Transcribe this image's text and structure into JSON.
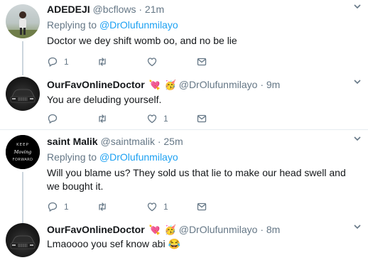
{
  "tweets": [
    {
      "name": "ADEDEJI",
      "handle": "@bcflows",
      "time": "· 21m",
      "replying_prefix": "Replying to",
      "replying_to": "@DrOlufunmilayo",
      "text": "Doctor we dey shift womb oo, and no be lie",
      "reply_count": "1",
      "retweet_count": "",
      "like_count": ""
    },
    {
      "name": "OurFavOnlineDoctor",
      "emojis": [
        "💘",
        "🥳"
      ],
      "handle": "@DrOlufunmilayo",
      "time": "· 9m",
      "text": "You are deluding yourself.",
      "reply_count": "",
      "retweet_count": "",
      "like_count": "1"
    },
    {
      "name": "saint Malik",
      "handle": "@saintmalik",
      "time": "· 25m",
      "replying_prefix": "Replying to",
      "replying_to": "@DrOlufunmilayo",
      "avatar_text": "KEEP MOVING FORWARD",
      "text": "Will you blame us? They sold us that lie to make our head swell and we bought it.",
      "reply_count": "1",
      "retweet_count": "",
      "like_count": "1"
    },
    {
      "name": "OurFavOnlineDoctor",
      "emojis": [
        "💘",
        "🥳"
      ],
      "handle": "@DrOlufunmilayo",
      "time": "· 8m",
      "text": "Lmaoooo you sef know abi 😂"
    }
  ],
  "colors": {
    "link": "#1da1f2",
    "muted": "#657786",
    "text": "#14171a",
    "divider": "#e6ecf0"
  },
  "icons": [
    "reply-icon",
    "retweet-icon",
    "like-icon",
    "message-icon",
    "chevron-down-icon"
  ]
}
